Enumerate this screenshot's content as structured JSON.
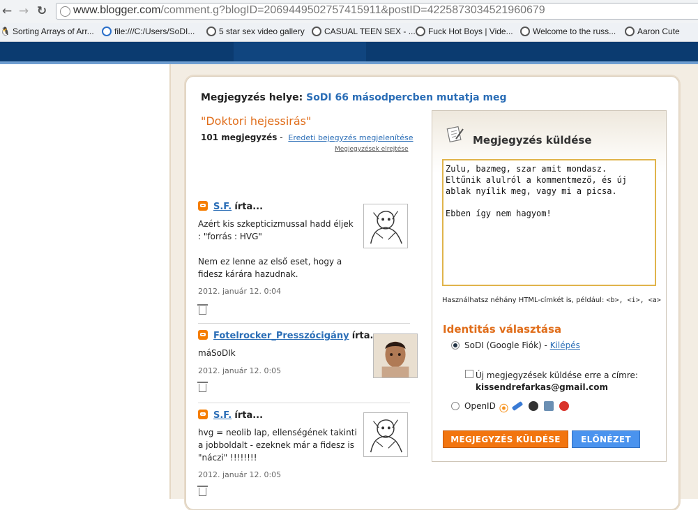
{
  "browser": {
    "url_host": "www.blogger.com",
    "url_rest": "/comment.g?blogID=2069449502757415911&postID=4225873034521960679",
    "bookmarks": [
      {
        "label": "Sorting Arrays of Arr...",
        "icon": "linux-icon"
      },
      {
        "label": "file:///C:/Users/SoDI...",
        "icon": "ie-icon"
      },
      {
        "label": "5 star sex video gallery",
        "icon": "globe-icon"
      },
      {
        "label": "CASUAL TEEN SEX - ...",
        "icon": "globe-icon"
      },
      {
        "label": "Fuck Hot Boys | Vide...",
        "icon": "globe-icon"
      },
      {
        "label": "Welcome to the russ...",
        "icon": "globe-icon"
      },
      {
        "label": "Aaron Cute",
        "icon": "globe-icon"
      }
    ]
  },
  "header": {
    "location_label": "Megjegyzés helye:",
    "blog_name": "SoDI 66 másodpercben mutatja meg",
    "post_title": "\"Doktori hejessirás\"",
    "comment_count": "101 megjegyzés",
    "count_sep": "-",
    "view_original": "Eredeti bejegyzés megjelenítése",
    "hide_comments": "Megjegyzések elrejtése"
  },
  "comments": [
    {
      "author": "S.F.",
      "wrote": "írta...",
      "body_lines": [
        "Azért kis szkepticizmussal hadd éljek : \"forrás : HVG\"",
        "Nem ez lenne az első eset, hogy a fidesz kárára hazudnak."
      ],
      "date": "2012. január 12. 0:04"
    },
    {
      "author": "Fotelrocker_Presszócigány",
      "wrote": "írta...",
      "body_lines": [
        "máSoDIk"
      ],
      "date": "2012. január 12. 0:05"
    },
    {
      "author": "S.F.",
      "wrote": "írta...",
      "body_lines": [
        "hvg = neolib lap, ellenségének takinti a jobboldalt - ezeknek már a fidesz is \"náczi\" !!!!!!!!"
      ],
      "date": "2012. január 12. 0:05"
    }
  ],
  "form": {
    "title": "Megjegyzés küldése",
    "textarea_value": "Zulu, bazmeg, szar amit mondasz.\nEltűnik alulról a kommentmező, és új\nablak nyílik meg, vagy mi a picsa.\n\nEbben így nem hagyom!",
    "html_hint_prefix": "Használhatsz néhány HTML-címkét is, például: ",
    "html_hint_tags": "<b>, <i>, <a>",
    "identity_title": "Identitás választása",
    "google_label": "SoDI (Google Fiók) -",
    "logout_link": "Kilépés",
    "email_checkbox_label": "Új megjegyzések küldése erre a címre:",
    "email": "kissendrefarkas@gmail.com",
    "openid_label": "OpenID",
    "submit_label": "MEGJEGYZÉS KÜLDÉSE",
    "preview_label": "ELŐNÉZET"
  },
  "colors": {
    "accent_orange": "#e06d1a",
    "link_blue": "#2a6db6",
    "banner_blue": "#0b3b70"
  }
}
